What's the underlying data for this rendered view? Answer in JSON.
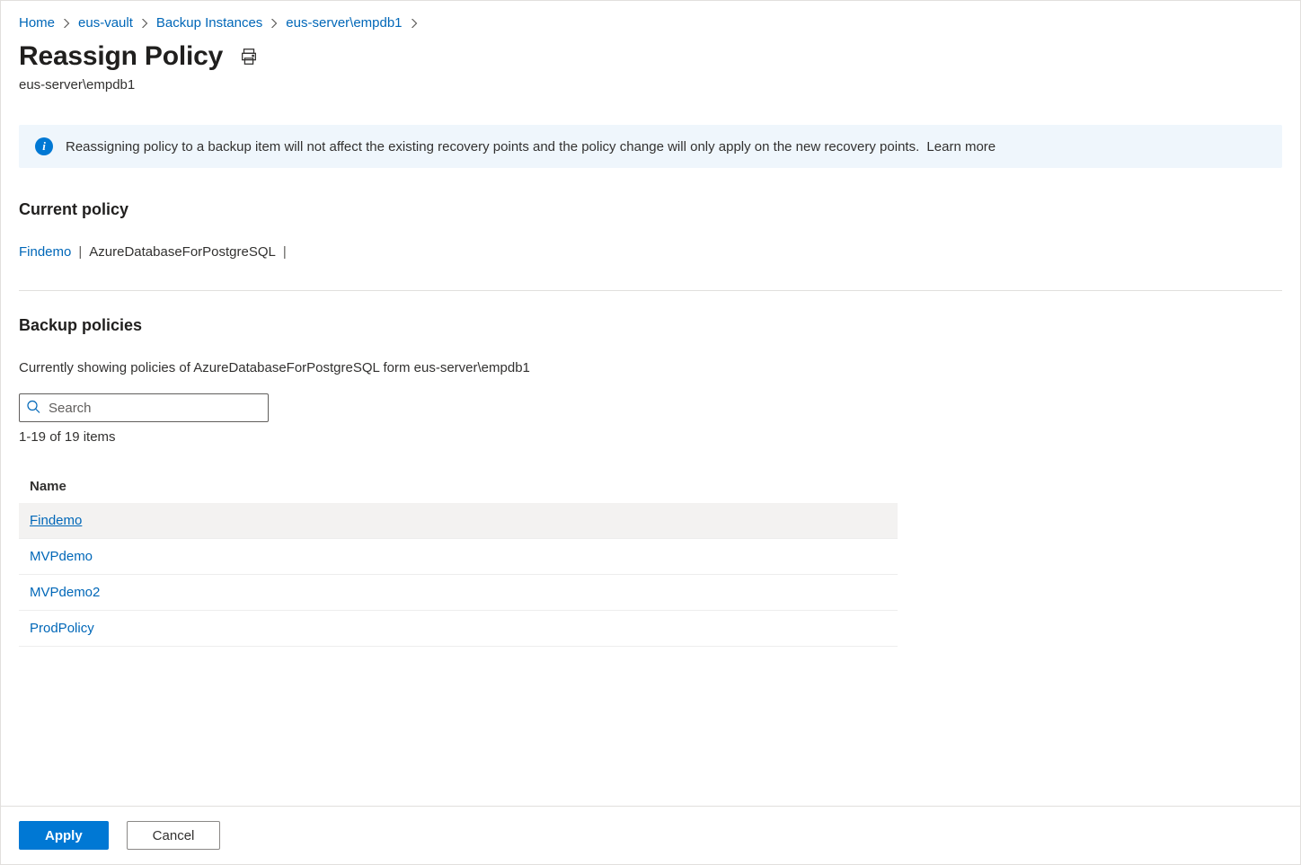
{
  "breadcrumb": {
    "items": [
      {
        "label": "Home"
      },
      {
        "label": "eus-vault"
      },
      {
        "label": "Backup Instances"
      },
      {
        "label": "eus-server\\empdb1"
      }
    ]
  },
  "header": {
    "title": "Reassign Policy",
    "subtitle": "eus-server\\empdb1"
  },
  "banner": {
    "text": "Reassigning policy to a backup item will not affect the existing recovery points and the policy change will only apply on the new recovery points.",
    "learn_more": "Learn more"
  },
  "current_policy": {
    "heading": "Current policy",
    "link": "Findemo",
    "type": "AzureDatabaseForPostgreSQL"
  },
  "backup_policies": {
    "heading": "Backup policies",
    "description": "Currently showing policies of AzureDatabaseForPostgreSQL form eus-server\\empdb1",
    "search_placeholder": "Search",
    "count_text": "1-19 of 19 items",
    "column_header": "Name",
    "rows": [
      {
        "name": "Findemo",
        "selected": true
      },
      {
        "name": "MVPdemo",
        "selected": false
      },
      {
        "name": "MVPdemo2",
        "selected": false
      },
      {
        "name": "ProdPolicy",
        "selected": false
      }
    ]
  },
  "footer": {
    "apply": "Apply",
    "cancel": "Cancel"
  }
}
